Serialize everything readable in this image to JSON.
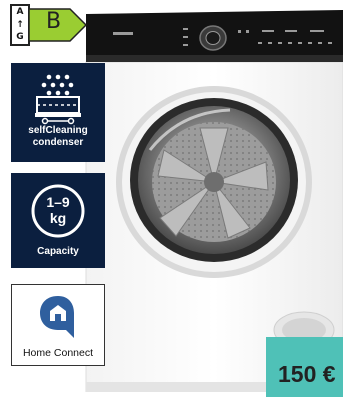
{
  "energy_label": {
    "scale_top": "A",
    "scale_arrow": "↑",
    "scale_bottom": "G",
    "class": "B",
    "class_color": "#9acd32"
  },
  "badges": [
    {
      "id": "self-cleaning",
      "label_line1": "selfCleaning",
      "label_line2": "condenser",
      "icon": "self-cleaning-condenser-icon"
    },
    {
      "id": "capacity",
      "value_line1": "1–9",
      "value_line2": "kg",
      "label": "Capacity",
      "icon": "capacity-icon"
    },
    {
      "id": "home-connect",
      "label": "Home Connect",
      "icon": "home-connect-icon"
    }
  ],
  "price": {
    "text": "150 €",
    "color": "#4fc1b7"
  },
  "colors": {
    "badge_bg": "#0b1f3f",
    "appliance_top": "#111111"
  }
}
